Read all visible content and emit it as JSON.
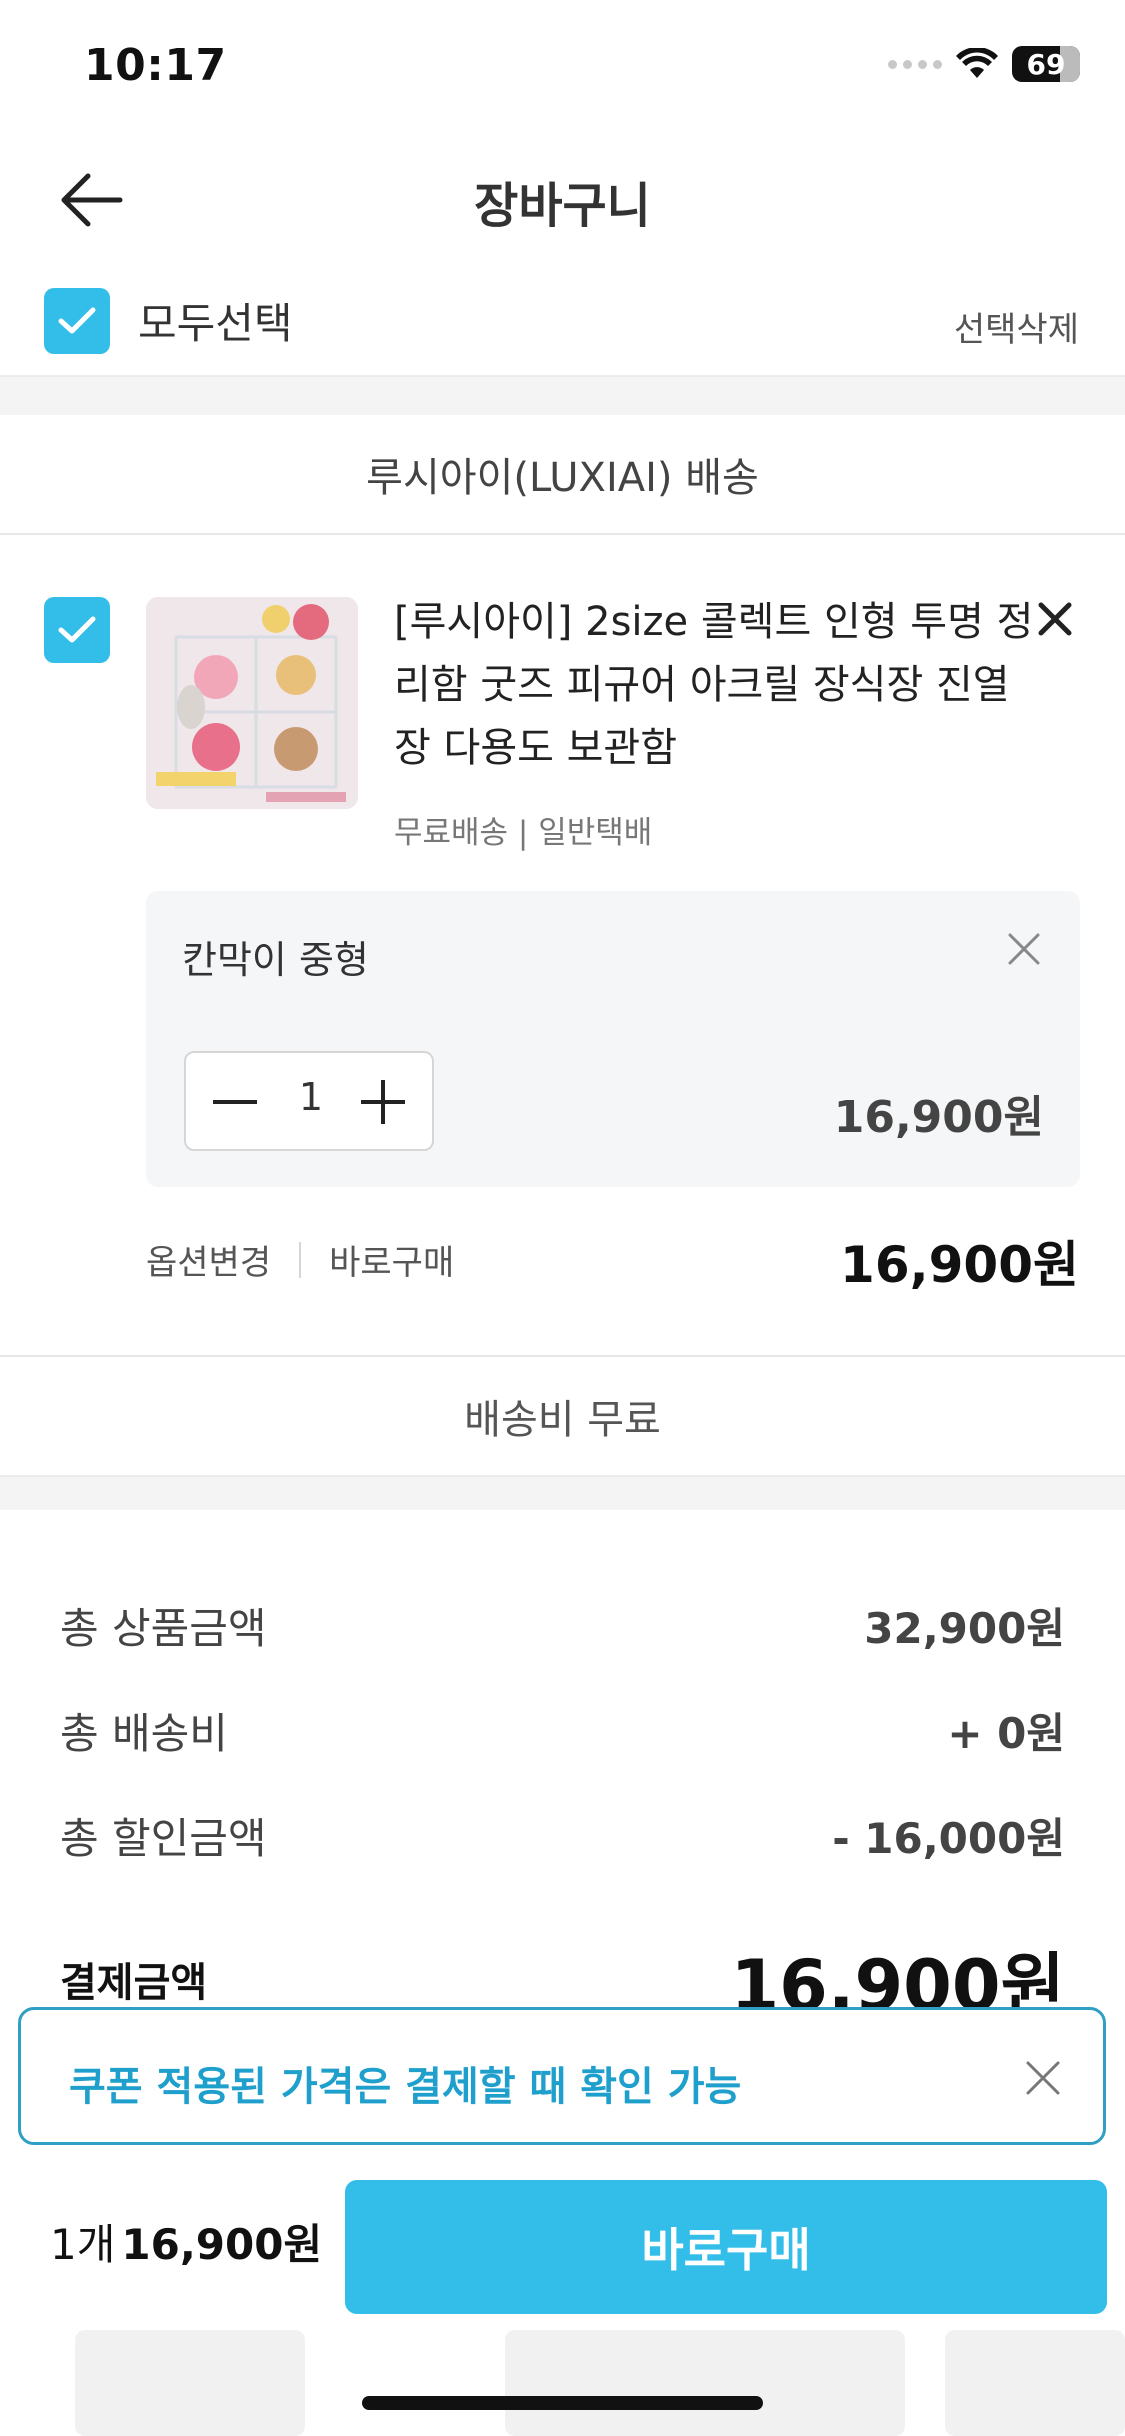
{
  "status_bar": {
    "time": "10:17",
    "battery": "69"
  },
  "header": {
    "title": "장바구니"
  },
  "select_all": {
    "label": "모두선택",
    "delete_label": "선택삭제",
    "checked": true
  },
  "seller": {
    "name": "루시아이(LUXIAI) 배송"
  },
  "product": {
    "title": "[루시아이] 2size 콜렉트 인형 투명 정리함 굿즈 피규어 아크릴 장식장 진열장 다용도 보관함",
    "shipping": "무료배송 | 일반택배",
    "option": {
      "name": "칸막이 중형",
      "quantity": "1",
      "price": "16,900원"
    },
    "actions": {
      "change_option": "옵션변경",
      "buy_now": "바로구매"
    },
    "total": "16,900원"
  },
  "shipping_fee": "배송비 무료",
  "summary": {
    "rows": [
      {
        "label": "총 상품금액",
        "value": "32,900원"
      },
      {
        "label": "총 배송비",
        "value": "+ 0원"
      },
      {
        "label": "총 할인금액",
        "value": "- 16,000원"
      }
    ],
    "pay_label": "결제금액",
    "pay_value": "16,900원"
  },
  "coupon_toast": {
    "text": "쿠폰 적용된 가격은 결제할 때 확인 가능"
  },
  "bottom_bar": {
    "count": "1개",
    "amount": "16,900원",
    "buy_label": "바로구매"
  },
  "colors": {
    "accent": "#33bde9",
    "toast_text": "#1f9fcc",
    "toast_border": "#2f9fc4"
  },
  "icons": [
    "back-arrow-icon",
    "checkmark-icon",
    "close-icon",
    "minus-icon",
    "plus-icon",
    "wifi-icon",
    "battery-icon"
  ]
}
